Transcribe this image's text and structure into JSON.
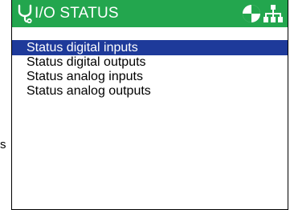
{
  "colors": {
    "titlebar_bg": "#23a64e",
    "selection_bg": "#1e3a9a",
    "text": "#000000",
    "background": "#ffffff"
  },
  "stray_char": "s",
  "header": {
    "title": "I/O STATUS",
    "title_icon": "stethoscope-icon",
    "status_icons": [
      "maintenance-indicator-icon",
      "network-icon"
    ]
  },
  "menu": {
    "selected_index": 0,
    "items": [
      {
        "label": "Status digital inputs"
      },
      {
        "label": "Status digital outputs"
      },
      {
        "label": "Status analog inputs"
      },
      {
        "label": "Status analog outputs"
      }
    ]
  }
}
